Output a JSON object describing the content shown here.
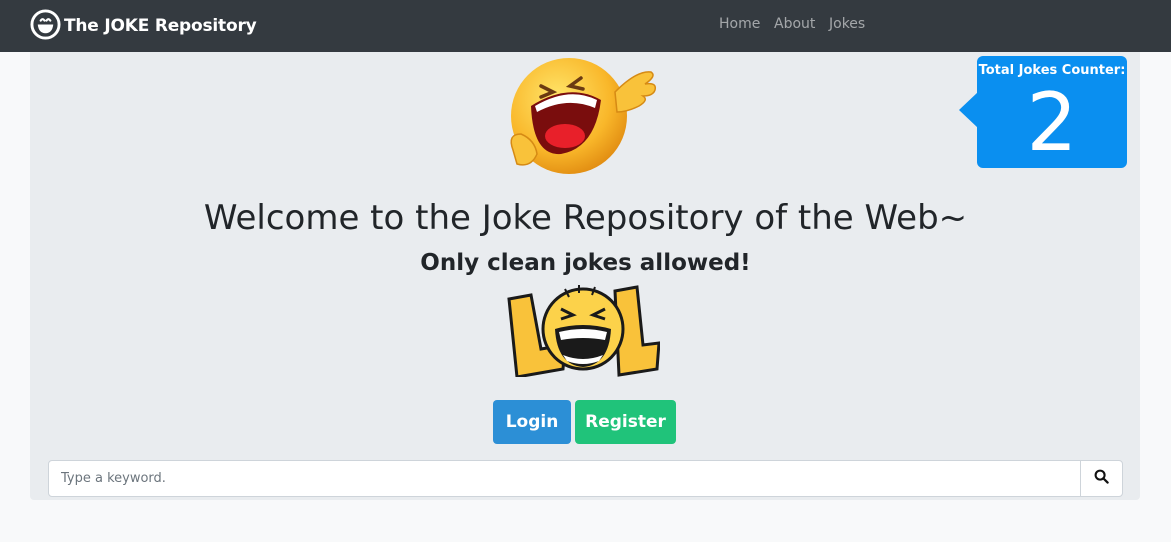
{
  "navbar": {
    "brand": "The JOKE Repository",
    "brand_icon": "grinning-face-icon",
    "links": [
      "Home",
      "About",
      "Jokes"
    ]
  },
  "counter": {
    "label": "Total Jokes Counter:",
    "value": "2",
    "color": "#0a8ff0"
  },
  "hero": {
    "title": "Welcome to the Joke Repository of the Web~",
    "subtitle": "Only clean jokes allowed!"
  },
  "images": {
    "top": "laughing-pointing-emoji",
    "bottom": "lol-laughing-face"
  },
  "buttons": {
    "login": "Login",
    "register": "Register"
  },
  "search": {
    "placeholder": "Type a keyword.",
    "value": "",
    "icon": "search-icon"
  },
  "colors": {
    "navbar": "#343a40",
    "jumbotron": "#e9ecef",
    "login": "#2c8fd6",
    "register": "#20c37a"
  }
}
